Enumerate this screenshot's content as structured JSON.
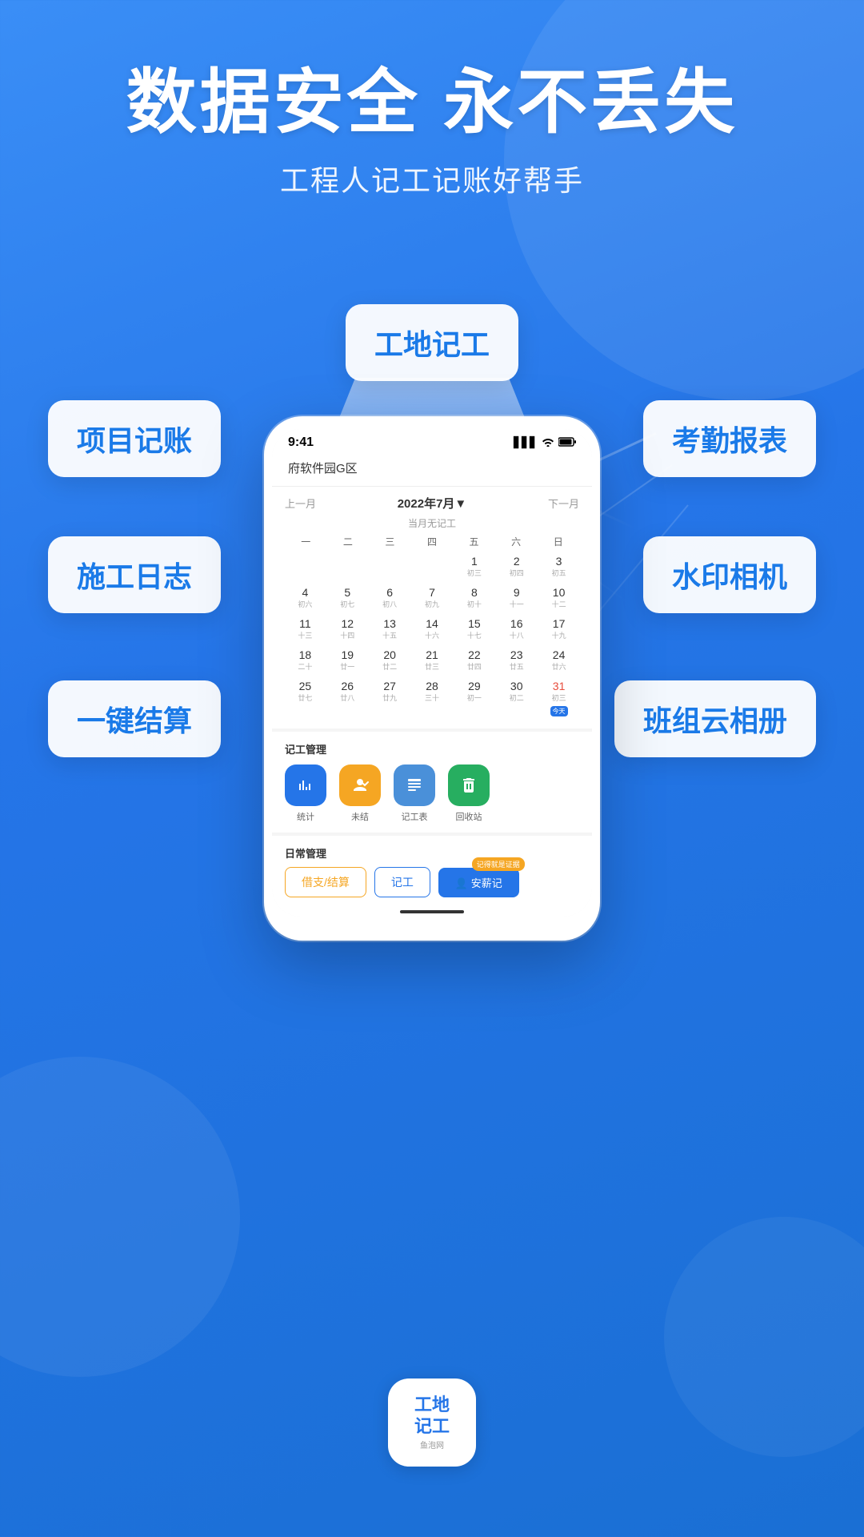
{
  "hero": {
    "title": "数据安全 永不丢失",
    "subtitle": "工程人记工记账好帮手"
  },
  "feature_cards": {
    "top_center": "工地记工",
    "mid_left": "项目记账",
    "mid_right": "考勤报表",
    "lower_left": "施工日志",
    "lower_right": "水印相机",
    "bottom_left": "一键结算",
    "bottom_right": "班组云相册"
  },
  "phone": {
    "status_bar": {
      "time": "9:41",
      "signal": "▋▋▋",
      "wifi": "WiFi",
      "battery": "🔋"
    },
    "header": {
      "location": "府软件园G区"
    },
    "calendar": {
      "prev_label": "上一月",
      "next_label": "下一月",
      "month_label": "2022年7月▼",
      "no_record": "当月无记工",
      "weekdays": [
        "一",
        "二",
        "三",
        "四",
        "五",
        "六",
        "日"
      ],
      "weeks": [
        [
          {
            "num": "",
            "lunar": ""
          },
          {
            "num": "",
            "lunar": ""
          },
          {
            "num": "",
            "lunar": ""
          },
          {
            "num": "",
            "lunar": ""
          },
          {
            "num": "1",
            "lunar": "初三"
          },
          {
            "num": "2",
            "lunar": "初四"
          },
          {
            "num": "3",
            "lunar": "初五"
          }
        ],
        [
          {
            "num": "4",
            "lunar": "初六"
          },
          {
            "num": "5",
            "lunar": "初七"
          },
          {
            "num": "6",
            "lunar": "初八"
          },
          {
            "num": "7",
            "lunar": "初九"
          },
          {
            "num": "8",
            "lunar": "初十"
          },
          {
            "num": "9",
            "lunar": "十一"
          },
          {
            "num": "10",
            "lunar": "十二"
          }
        ],
        [
          {
            "num": "11",
            "lunar": "十三"
          },
          {
            "num": "12",
            "lunar": "十四"
          },
          {
            "num": "13",
            "lunar": "十五"
          },
          {
            "num": "14",
            "lunar": "十六"
          },
          {
            "num": "15",
            "lunar": "十七"
          },
          {
            "num": "16",
            "lunar": "十八"
          },
          {
            "num": "17",
            "lunar": "十九"
          }
        ],
        [
          {
            "num": "18",
            "lunar": "二十"
          },
          {
            "num": "19",
            "lunar": "廿一"
          },
          {
            "num": "20",
            "lunar": "廿二"
          },
          {
            "num": "21",
            "lunar": "廿三"
          },
          {
            "num": "22",
            "lunar": "廿四"
          },
          {
            "num": "23",
            "lunar": "廿五"
          },
          {
            "num": "24",
            "lunar": "廿六"
          }
        ],
        [
          {
            "num": "25",
            "lunar": "廿七"
          },
          {
            "num": "26",
            "lunar": "廿八"
          },
          {
            "num": "27",
            "lunar": "廿九"
          },
          {
            "num": "28",
            "lunar": "三十"
          },
          {
            "num": "29",
            "lunar": "初一"
          },
          {
            "num": "30",
            "lunar": "初二"
          },
          {
            "num": "31",
            "lunar": "初三",
            "today": true
          }
        ]
      ]
    },
    "mgmt_section": {
      "title": "记工管理",
      "items": [
        {
          "icon": "¥",
          "label": "统计",
          "color": "blue"
        },
        {
          "icon": "🔒",
          "label": "未结",
          "color": "orange"
        },
        {
          "icon": "📋",
          "label": "记工表",
          "color": "blue2"
        },
        {
          "icon": "🗑",
          "label": "回收站",
          "color": "green"
        }
      ]
    },
    "daily_section": {
      "title": "日常管理",
      "buttons": [
        {
          "label": "借支/结算",
          "type": "outline-orange"
        },
        {
          "label": "记工",
          "type": "outline-blue"
        },
        {
          "label": "安薪记",
          "type": "filled-blue",
          "badge": "记得就是证据",
          "icon": "👤"
        }
      ]
    }
  },
  "app_icon": {
    "line1": "工地",
    "line2": "记工",
    "sub": "鱼泡网"
  }
}
